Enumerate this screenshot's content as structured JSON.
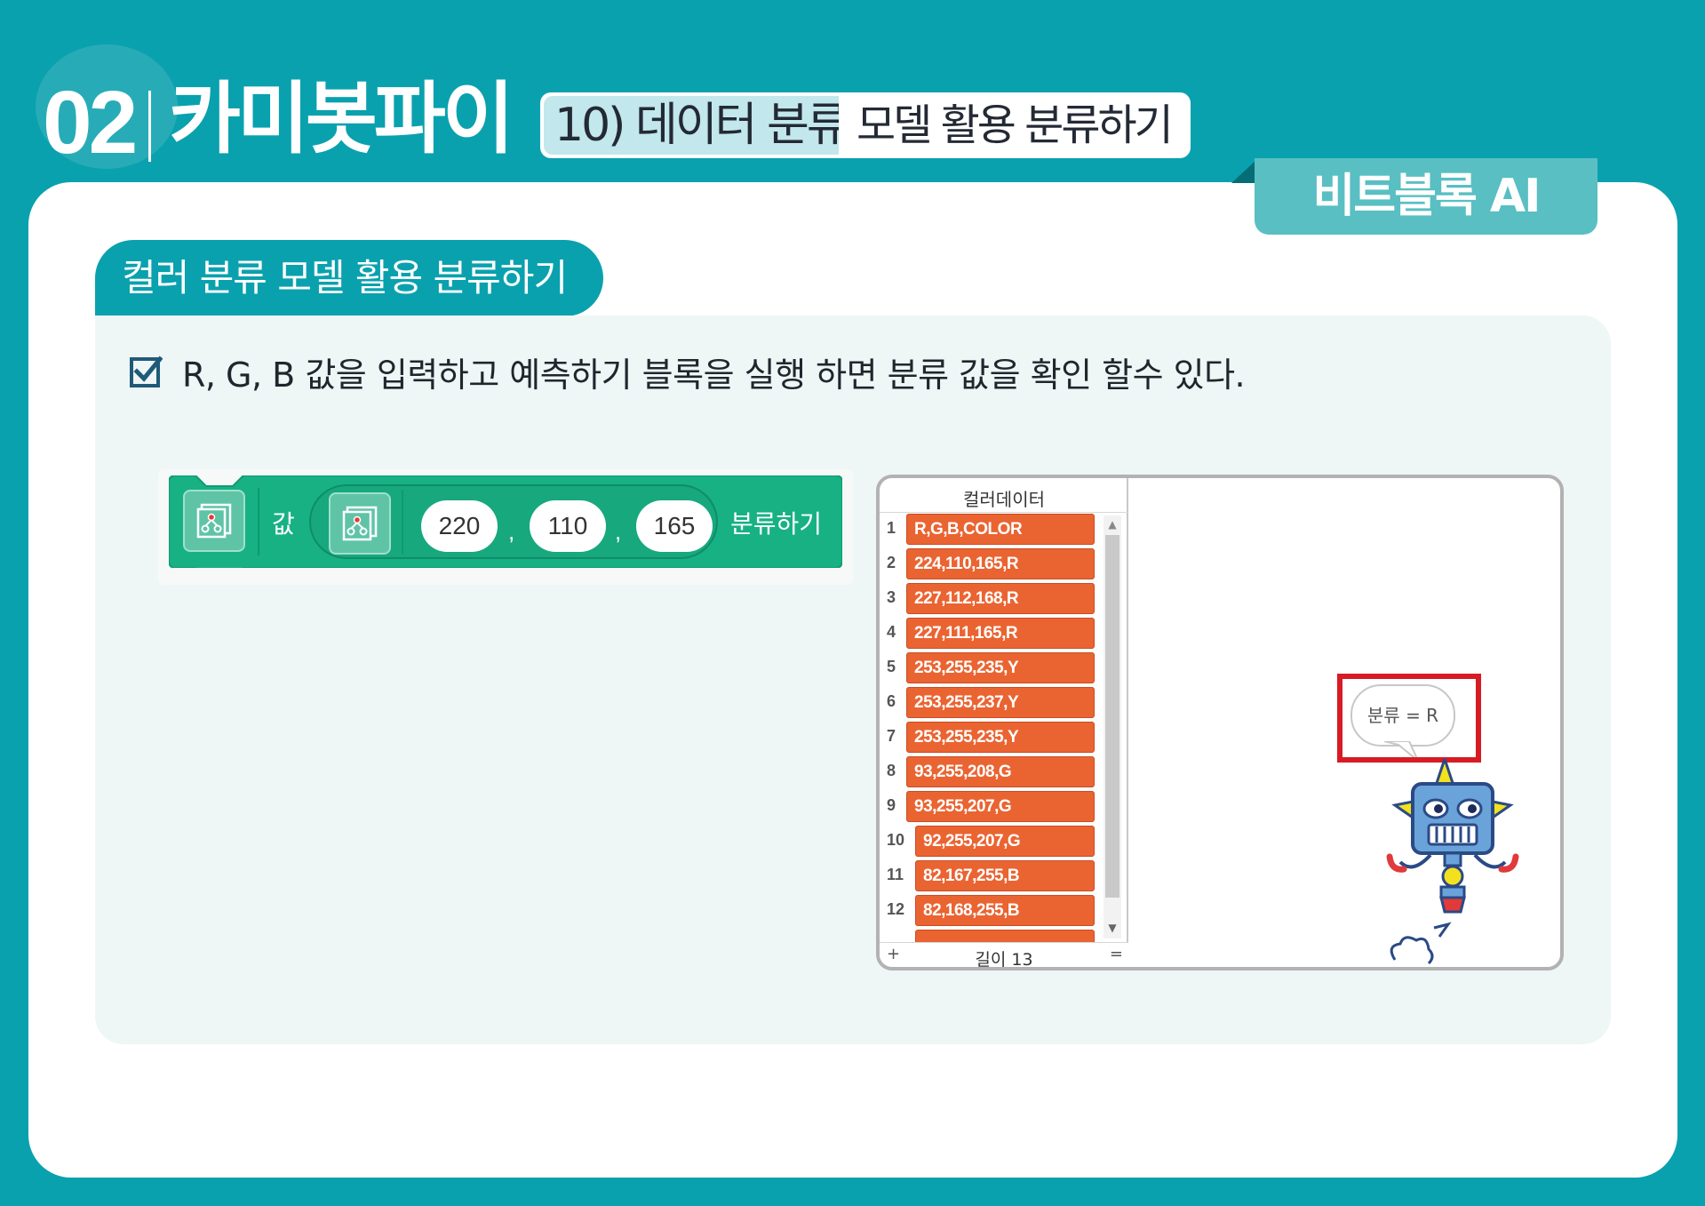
{
  "header": {
    "chapter_number": "02",
    "chapter_title": "카미봇파이",
    "lesson": "10) 데이터 분류",
    "lesson_sub": "모델 활용 분류하기"
  },
  "tag": {
    "label": "비트블록 AI"
  },
  "section": {
    "title": "컬러 분류 모델 활용 분류하기",
    "instruction": "R, G, B 값을 입력하고 예측하기 블록을 실행 하면 분류 값을 확인 할수 있다."
  },
  "block": {
    "value_label": "값",
    "inputs": [
      "220",
      "110",
      "165"
    ],
    "separator": ",",
    "action_label": "분류하기",
    "color": "#17b184"
  },
  "stage": {
    "list": {
      "title": "컬러데이터",
      "rows": [
        {
          "index": "1",
          "value": "R,G,B,COLOR"
        },
        {
          "index": "2",
          "value": "224,110,165,R"
        },
        {
          "index": "3",
          "value": "227,112,168,R"
        },
        {
          "index": "4",
          "value": "227,111,165,R"
        },
        {
          "index": "5",
          "value": "253,255,235,Y"
        },
        {
          "index": "6",
          "value": "253,255,237,Y"
        },
        {
          "index": "7",
          "value": "253,255,235,Y"
        },
        {
          "index": "8",
          "value": "93,255,208,G"
        },
        {
          "index": "9",
          "value": "93,255,207,G"
        },
        {
          "index": "10",
          "value": "92,255,207,G"
        },
        {
          "index": "11",
          "value": "82,167,255,B"
        },
        {
          "index": "12",
          "value": "82,168,255,B"
        }
      ],
      "add_button": "+",
      "length_label": "길이 13",
      "resize_handle": "="
    },
    "speech_bubble": "분류 = R",
    "highlight_color": "#d71b24"
  },
  "colors": {
    "background": "#0aa1ae",
    "accent": "#59bfc3",
    "list_item": "#ea6432"
  }
}
